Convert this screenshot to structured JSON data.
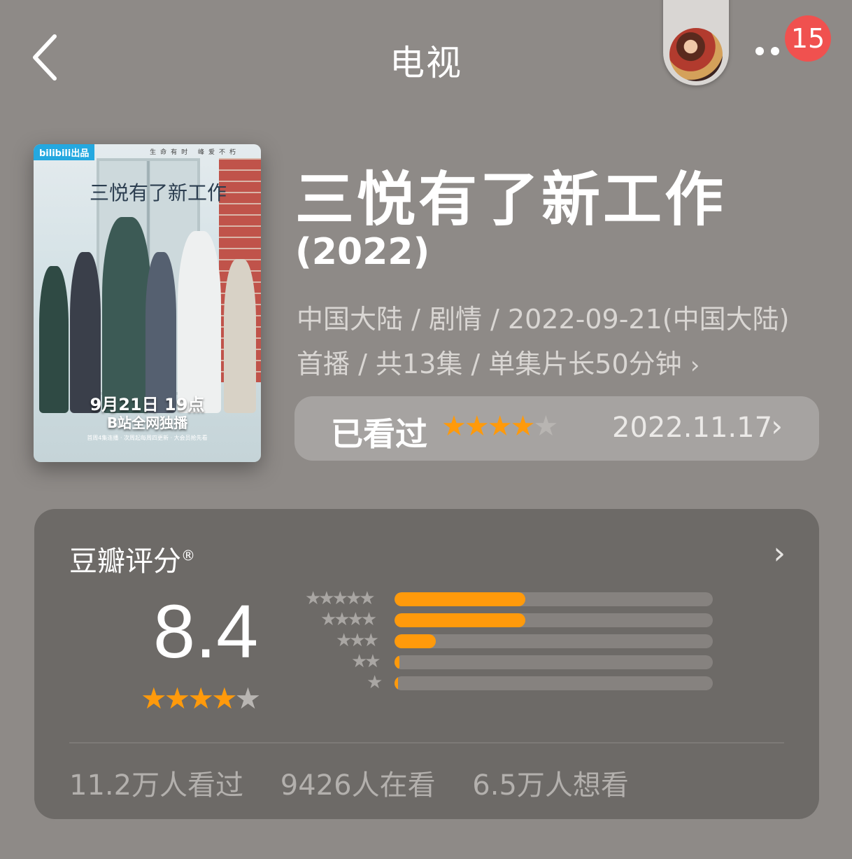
{
  "header": {
    "title": "电视",
    "notification_count": "15"
  },
  "poster": {
    "logo": "bilibili出品",
    "tagline": "生命有时 峰爱不朽",
    "title": "三悦有了新工作",
    "date_line": "9月21日 19点",
    "platform_line": "B站全网独播",
    "sub_line": "首周4集连播 · 次周起每周四更新 · 大会员抢先看"
  },
  "show": {
    "title": "三悦有了新工作",
    "year": "(2022)",
    "meta_line1": "中国大陆 / 剧情 / 2022-09-21(中国大陆)",
    "meta_line2": "首播 / 共13集 / 单集片长50分钟"
  },
  "watched": {
    "label": "已看过",
    "stars": 4,
    "max_stars": 5,
    "date": "2022.11.17"
  },
  "rating": {
    "title": "豆瓣评分",
    "reg_mark": "®",
    "score": "8.4",
    "score_stars": 4,
    "distribution": [
      {
        "stars": 5,
        "fraction": 0.41
      },
      {
        "stars": 4,
        "fraction": 0.41
      },
      {
        "stars": 3,
        "fraction": 0.13
      },
      {
        "stars": 2,
        "fraction": 0.015
      },
      {
        "stars": 1,
        "fraction": 0.006
      }
    ],
    "stats": [
      "11.2万人看过",
      "9426人在看",
      "6.5万人想看"
    ]
  },
  "colors": {
    "background": "#8e8a87",
    "accent_star": "#ff9a0b",
    "badge": "#f0514f",
    "card": "#6d6a67"
  }
}
